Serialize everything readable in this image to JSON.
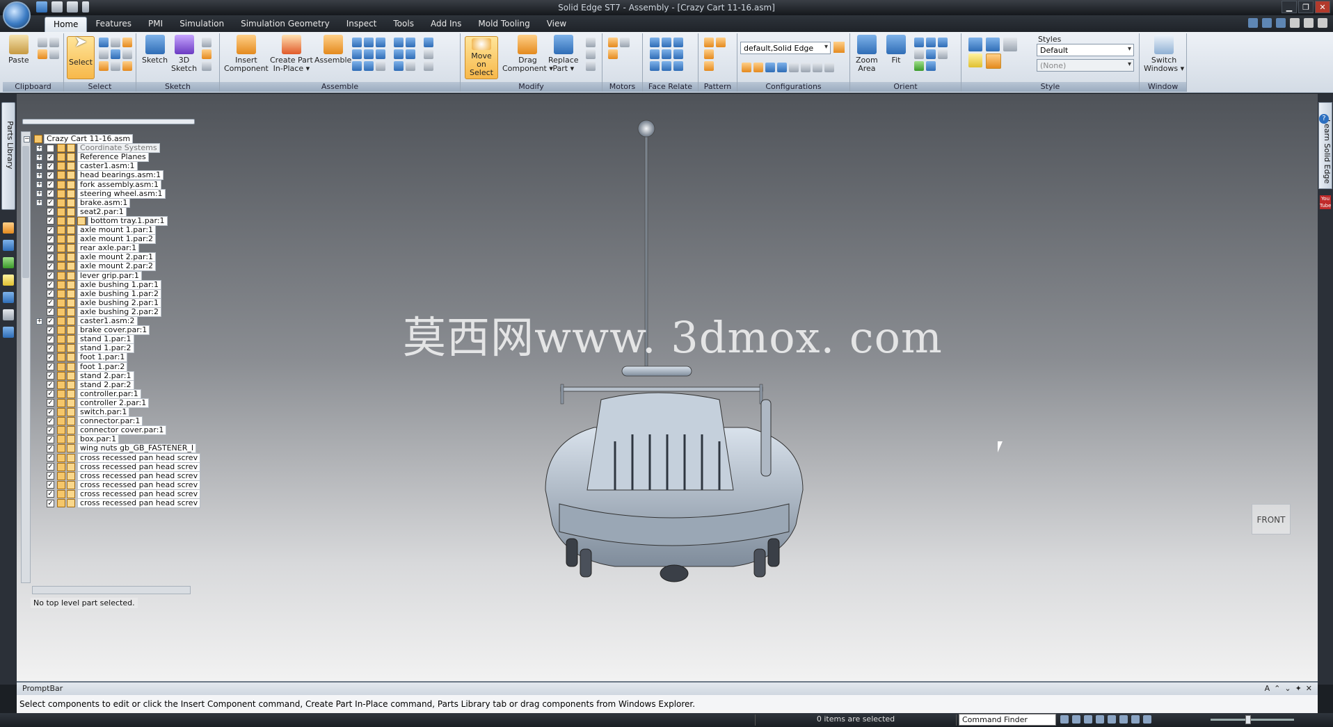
{
  "window": {
    "title": "Solid Edge ST7 - Assembly - [Crazy Cart 11-16.asm]",
    "controls": [
      "minimize-icon",
      "restore-icon",
      "close-icon"
    ]
  },
  "tabs": [
    "Home",
    "Features",
    "PMI",
    "Simulation",
    "Simulation Geometry",
    "Inspect",
    "Tools",
    "Add Ins",
    "Mold Tooling",
    "View"
  ],
  "active_tab": "Home",
  "ribbon": {
    "clipboard": {
      "label": "Clipboard",
      "paste": "Paste"
    },
    "select": {
      "label": "Select",
      "select_btn": "Select"
    },
    "sketch": {
      "label": "Sketch",
      "sketch_btn": "Sketch",
      "sketch3d_1": "3D",
      "sketch3d_2": "Sketch"
    },
    "assemble": {
      "label": "Assemble",
      "insert_1": "Insert",
      "insert_2": "Component",
      "create_1": "Create Part",
      "create_2": "In-Place ▾",
      "assemble_btn": "Assemble"
    },
    "modify": {
      "label": "Modify",
      "move_1": "Move on",
      "move_2": "Select",
      "drag_1": "Drag",
      "drag_2": "Component ▾",
      "replace_1": "Replace",
      "replace_2": "Part ▾"
    },
    "motors": {
      "label": "Motors"
    },
    "face_relate": {
      "label": "Face Relate"
    },
    "pattern": {
      "label": "Pattern"
    },
    "configurations": {
      "label": "Configurations",
      "value": "default,Solid Edge"
    },
    "orient": {
      "label": "Orient",
      "zoom_1": "Zoom",
      "zoom_2": "Area",
      "fit": "Fit"
    },
    "style": {
      "label": "Style",
      "styles_title": "Styles",
      "style_value": "Default",
      "style_none": "(None)"
    },
    "window": {
      "label": "Window",
      "switch_1": "Switch",
      "switch_2": "Windows ▾"
    }
  },
  "side_tabs": {
    "left": "Parts Library",
    "right": "Learn Solid Edge",
    "right_q": "?",
    "youtube": "You Tube"
  },
  "tree": {
    "root": "Crazy Cart 11-16.asm",
    "items": [
      {
        "label": "Coordinate Systems",
        "expand": "+",
        "checked": "",
        "gray": true
      },
      {
        "label": "Reference Planes",
        "expand": "+",
        "checked": "✓"
      },
      {
        "label": "caster1.asm:1",
        "expand": "+",
        "checked": "✓"
      },
      {
        "label": "head bearings.asm:1",
        "expand": "+",
        "checked": "✓"
      },
      {
        "label": "fork assembly.asm:1",
        "expand": "+",
        "checked": "✓"
      },
      {
        "label": "steering wheel.asm:1",
        "expand": "+",
        "checked": "✓"
      },
      {
        "label": "brake.asm:1",
        "expand": "+",
        "checked": "✓"
      },
      {
        "label": "seat2.par:1",
        "expand": "",
        "checked": "✓"
      },
      {
        "label": "bottom tray.1.par:1",
        "expand": "",
        "checked": "✓",
        "extra_icon": true
      },
      {
        "label": "axle mount 1.par:1",
        "expand": "",
        "checked": "✓"
      },
      {
        "label": "axle mount 1.par:2",
        "expand": "",
        "checked": "✓"
      },
      {
        "label": "rear axle.par:1",
        "expand": "",
        "checked": "✓"
      },
      {
        "label": "axle mount 2.par:1",
        "expand": "",
        "checked": "✓"
      },
      {
        "label": "axle mount 2.par:2",
        "expand": "",
        "checked": "✓"
      },
      {
        "label": "lever grip.par:1",
        "expand": "",
        "checked": "✓"
      },
      {
        "label": "axle bushing 1.par:1",
        "expand": "",
        "checked": "✓"
      },
      {
        "label": "axle bushing 1.par:2",
        "expand": "",
        "checked": "✓"
      },
      {
        "label": "axle bushing 2.par:1",
        "expand": "",
        "checked": "✓"
      },
      {
        "label": "axle bushing 2.par:2",
        "expand": "",
        "checked": "✓"
      },
      {
        "label": "caster1.asm:2",
        "expand": "+",
        "checked": "✓"
      },
      {
        "label": "brake cover.par:1",
        "expand": "",
        "checked": "✓"
      },
      {
        "label": "stand 1.par:1",
        "expand": "",
        "checked": "✓"
      },
      {
        "label": "stand 1.par:2",
        "expand": "",
        "checked": "✓"
      },
      {
        "label": "foot 1.par:1",
        "expand": "",
        "checked": "✓"
      },
      {
        "label": "foot 1.par:2",
        "expand": "",
        "checked": "✓"
      },
      {
        "label": "stand 2.par:1",
        "expand": "",
        "checked": "✓"
      },
      {
        "label": "stand 2.par:2",
        "expand": "",
        "checked": "✓"
      },
      {
        "label": "controller.par:1",
        "expand": "",
        "checked": "✓"
      },
      {
        "label": "controller 2.par:1",
        "expand": "",
        "checked": "✓"
      },
      {
        "label": "switch.par:1",
        "expand": "",
        "checked": "✓"
      },
      {
        "label": "connector.par:1",
        "expand": "",
        "checked": "✓"
      },
      {
        "label": "connector cover.par:1",
        "expand": "",
        "checked": "✓"
      },
      {
        "label": "box.par:1",
        "expand": "",
        "checked": "✓"
      },
      {
        "label": "wing nuts gb_GB_FASTENER_I",
        "expand": "",
        "checked": "✓"
      },
      {
        "label": "cross recessed pan head screv",
        "expand": "",
        "checked": "✓"
      },
      {
        "label": "cross recessed pan head screv",
        "expand": "",
        "checked": "✓"
      },
      {
        "label": "cross recessed pan head screv",
        "expand": "",
        "checked": "✓"
      },
      {
        "label": "cross recessed pan head screv",
        "expand": "",
        "checked": "✓"
      },
      {
        "label": "cross recessed pan head screv",
        "expand": "",
        "checked": "✓"
      },
      {
        "label": "cross recessed pan head screv",
        "expand": "",
        "checked": "✓"
      }
    ],
    "status": "No top level part selected."
  },
  "viewport": {
    "watermark": "莫西网www. 3dmox. com",
    "view_label": "FRONT"
  },
  "promptbar": {
    "title": "PromptBar",
    "text": "Select components to edit or click the Insert Component command, Create Part In-Place command, Parts Library tab or drag components from Windows Explorer."
  },
  "statusbar": {
    "selection": "0 items are selected",
    "command_finder": "Command Finder"
  },
  "colors": {
    "accent": "#f7b84a",
    "ribbon": "#dfe6ee",
    "title": "#15181c"
  }
}
